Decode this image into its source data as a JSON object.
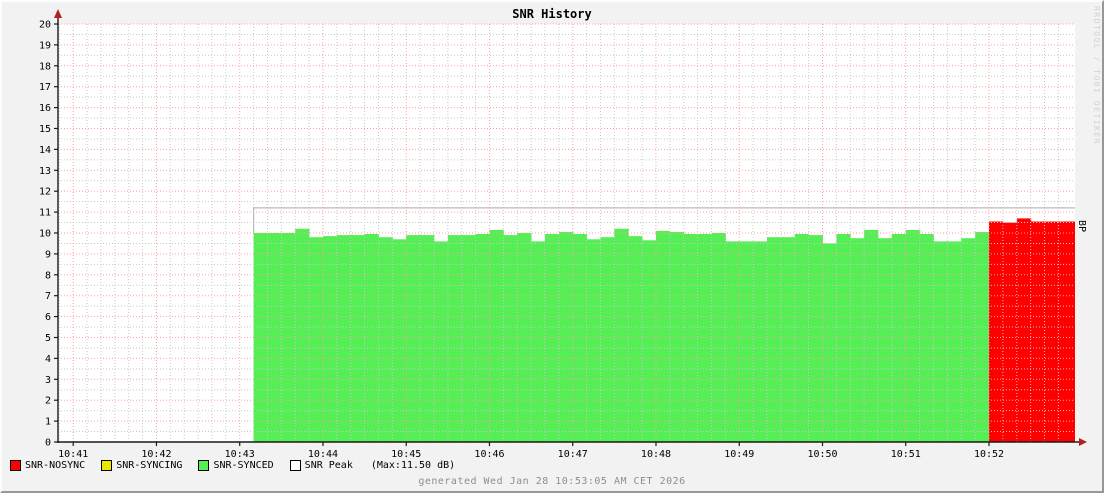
{
  "title": "SNR History",
  "watermark": "RRDTOOL / TOBI OETIKER",
  "right_axis_label": "BP",
  "footer": "generated Wed Jan 28 10:53:05 AM CET 2026",
  "colors": {
    "background": "#f2f2f2",
    "canvas": "#ffffff",
    "major_grid": "#ffa0a0",
    "minor_grid": "#c9c9c9",
    "axis": "#1a1a1a",
    "arrow": "#b22222",
    "synced_green": "#55ee55",
    "nosync_red": "#ff0000",
    "syncing_yellow": "#e8e800",
    "peak_gray": "#bababa"
  },
  "legend": {
    "items": [
      {
        "label": "SNR-NOSYNC",
        "color": "#ff0000"
      },
      {
        "label": "SNR-SYNCING",
        "color": "#e8e800"
      },
      {
        "label": "SNR-SYNCED",
        "color": "#55ee55"
      },
      {
        "label": "SNR Peak",
        "color": "#ffffff"
      }
    ],
    "max_note": "(Max:11.50 dB)"
  },
  "chart_data": {
    "type": "bar",
    "title": "SNR History",
    "ylabel_right": "BP",
    "unit": "dB",
    "ylim": [
      0,
      20
    ],
    "y_tick_step": 1,
    "y_minor_step": 0.5,
    "x_domain": [
      "10:40:49",
      "10:53:03"
    ],
    "x_ticks": [
      "10:41",
      "10:42",
      "10:43",
      "10:44",
      "10:45",
      "10:46",
      "10:47",
      "10:48",
      "10:49",
      "10:50",
      "10:51",
      "10:52"
    ],
    "x_minor_seconds": 10,
    "grid": true,
    "legend_position": "bottom",
    "series": [
      {
        "name": "SNR-SYNCED",
        "color": "#55ee55",
        "start": "10:43:10",
        "step_seconds": 10,
        "extend_to_end": false,
        "values": [
          10.0,
          10.0,
          10.0,
          10.2,
          9.8,
          9.85,
          9.9,
          9.9,
          9.95,
          9.8,
          9.7,
          9.9,
          9.9,
          9.6,
          9.9,
          9.9,
          9.95,
          10.15,
          9.9,
          10.0,
          9.6,
          9.95,
          10.05,
          9.95,
          9.7,
          9.8,
          10.2,
          9.85,
          9.65,
          10.1,
          10.05,
          9.95,
          9.95,
          10.0,
          9.6,
          9.6,
          9.6,
          9.8,
          9.8,
          9.95,
          9.9,
          9.5,
          9.95,
          9.75,
          10.15,
          9.75,
          9.95,
          10.15,
          9.95,
          9.6,
          9.6,
          9.75,
          10.05
        ]
      },
      {
        "name": "SNR-NOSYNC",
        "color": "#ff0000",
        "start": "10:52:00",
        "step_seconds": 10,
        "extend_to_end": true,
        "values": [
          10.55,
          10.5,
          10.7,
          10.55,
          10.55,
          10.55
        ]
      }
    ],
    "peak_line": {
      "name": "SNR Peak",
      "color": "#bababa",
      "value": 11.2,
      "max_label": 11.5,
      "start": "10:43:10",
      "end": "10:53:03"
    }
  }
}
